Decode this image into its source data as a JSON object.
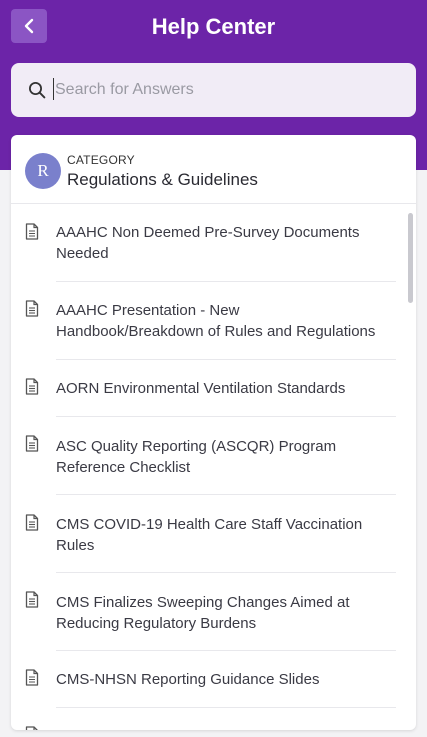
{
  "header": {
    "title": "Help Center"
  },
  "search": {
    "placeholder": "Search for Answers",
    "value": ""
  },
  "category": {
    "avatar_letter": "R",
    "label": "CATEGORY",
    "name": "Regulations & Guidelines"
  },
  "articles": [
    {
      "line1": "AAAHC Non Deemed Pre-Survey Documents",
      "line2": "Needed"
    },
    {
      "line1": "AAAHC Presentation - New",
      "line2": "Handbook/Breakdown of Rules and Regulations"
    },
    {
      "line1": "AORN Environmental Ventilation Standards",
      "line2": ""
    },
    {
      "line1": "ASC Quality Reporting (ASCQR) Program",
      "line2": "Reference Checklist"
    },
    {
      "line1": "CMS COVID-19 Health Care Staff Vaccination",
      "line2": "Rules"
    },
    {
      "line1": "CMS Finalizes Sweeping Changes Aimed at",
      "line2": "Reducing Regulatory Burdens"
    },
    {
      "line1": "CMS-NHSN Reporting Guidance Slides",
      "line2": ""
    }
  ],
  "colors": {
    "header": "#6c24a8",
    "back_button": "#8b55c4",
    "avatar": "#7a80cc"
  }
}
